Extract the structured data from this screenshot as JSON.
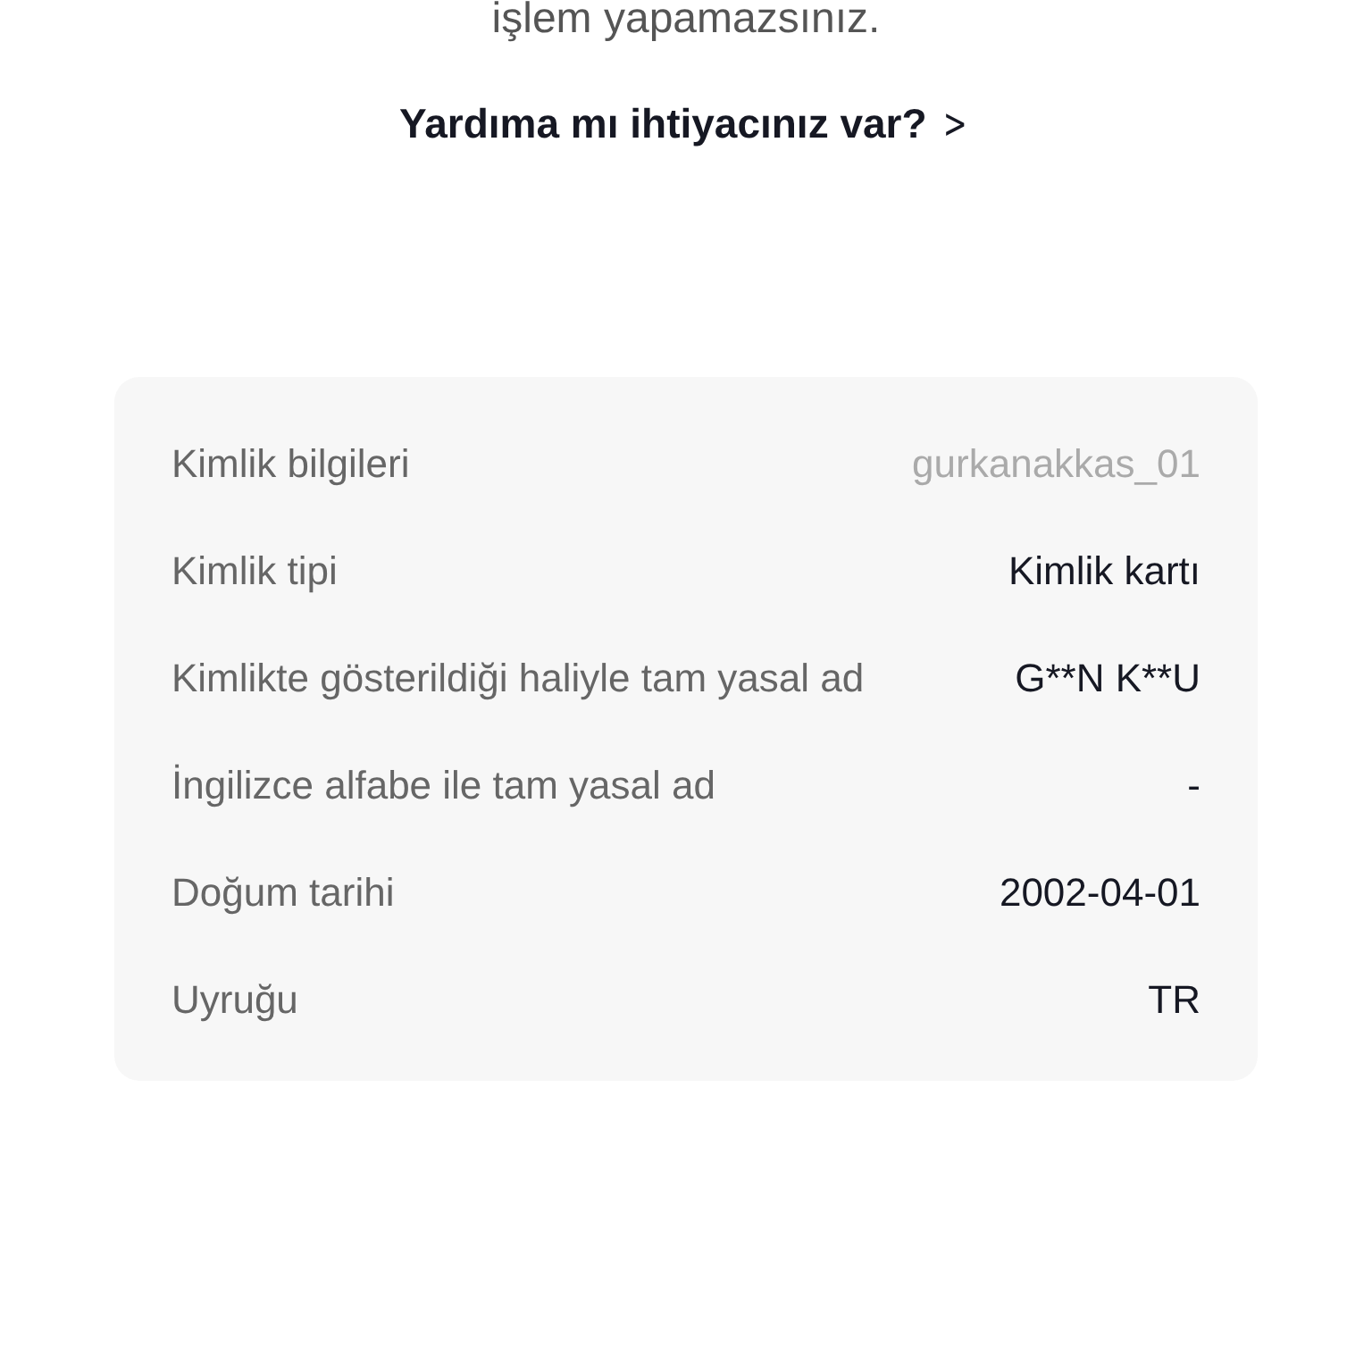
{
  "notice": "işlem yapamazsınız.",
  "help_link": {
    "label": "Yardıma mı ihtiyacınız var?",
    "icon": ">"
  },
  "identity_rows": [
    {
      "label": "Kimlik bilgileri",
      "value": "gurkanakkas_01",
      "muted": true
    },
    {
      "label": "Kimlik tipi",
      "value": "Kimlik kartı",
      "muted": false
    },
    {
      "label": "Kimlikte gösterildiği haliyle tam yasal ad",
      "value": "G**N K**U",
      "muted": false
    },
    {
      "label": "İngilizce alfabe ile tam yasal ad",
      "value": "-",
      "muted": false
    },
    {
      "label": "Doğum tarihi",
      "value": "2002-04-01",
      "muted": false
    },
    {
      "label": "Uyruğu",
      "value": "TR",
      "muted": false
    }
  ]
}
